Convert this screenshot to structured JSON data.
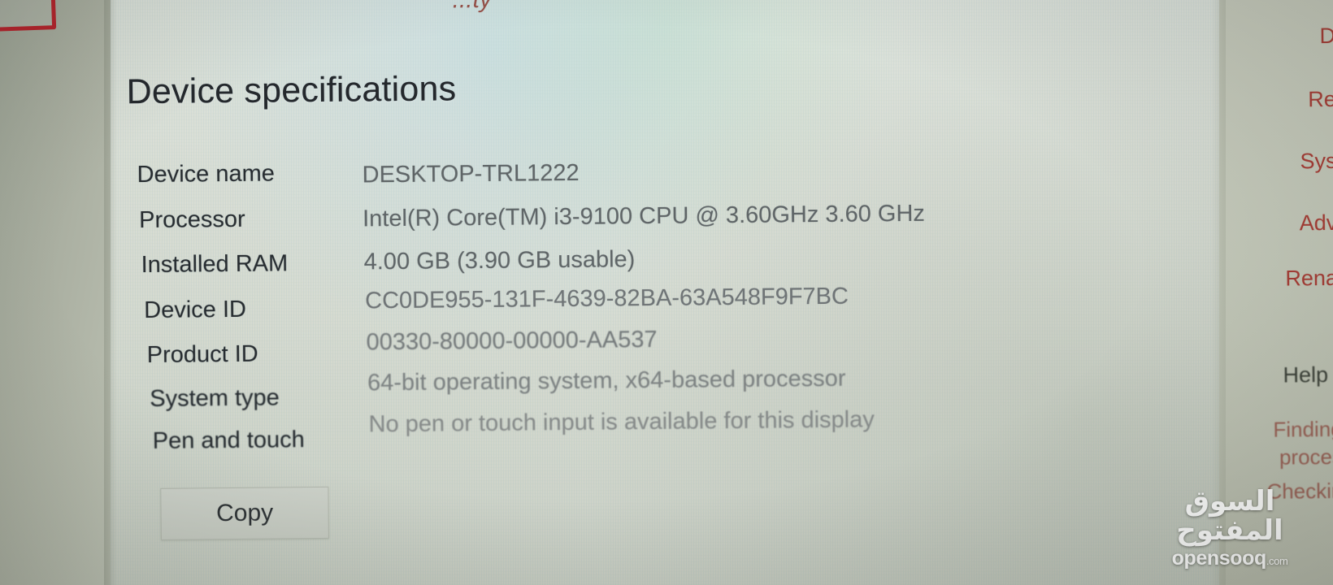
{
  "window": {
    "page_title": "Device specifications",
    "cut_top_text": "...ty"
  },
  "specifications": {
    "rows": [
      {
        "label": "Device name",
        "value": "DESKTOP-TRL1222"
      },
      {
        "label": "Processor",
        "value": "Intel(R) Core(TM) i3-9100 CPU @ 3.60GHz   3.60 GHz"
      },
      {
        "label": "Installed RAM",
        "value": "4.00 GB (3.90 GB usable)"
      },
      {
        "label": "Device ID",
        "value": "CC0DE955-131F-4639-82BA-63A548F9F7BC"
      },
      {
        "label": "Product ID",
        "value": "00330-80000-00000-AA537"
      },
      {
        "label": "System type",
        "value": "64-bit operating system, x64-based processor"
      },
      {
        "label": "Pen and touch",
        "value": "No pen or touch input is available for this display"
      }
    ],
    "copy_button": "Copy"
  },
  "related_settings": {
    "heading_top": "D",
    "links": [
      "Re",
      "Sys",
      "Adv",
      "Rena"
    ],
    "help_heading": "Help f",
    "help_links": [
      "Finding",
      "proces",
      "Checkin"
    ]
  },
  "watermark": {
    "arabic": "السوق المفتوح",
    "latin": "opensooq",
    "suffix": ".com"
  },
  "colors": {
    "accent_link": "#a63a33",
    "marker_box": "#b3222b",
    "label_text": "#262b2f",
    "value_text": "#5e6466",
    "screen_bg": "#dde4dc"
  }
}
